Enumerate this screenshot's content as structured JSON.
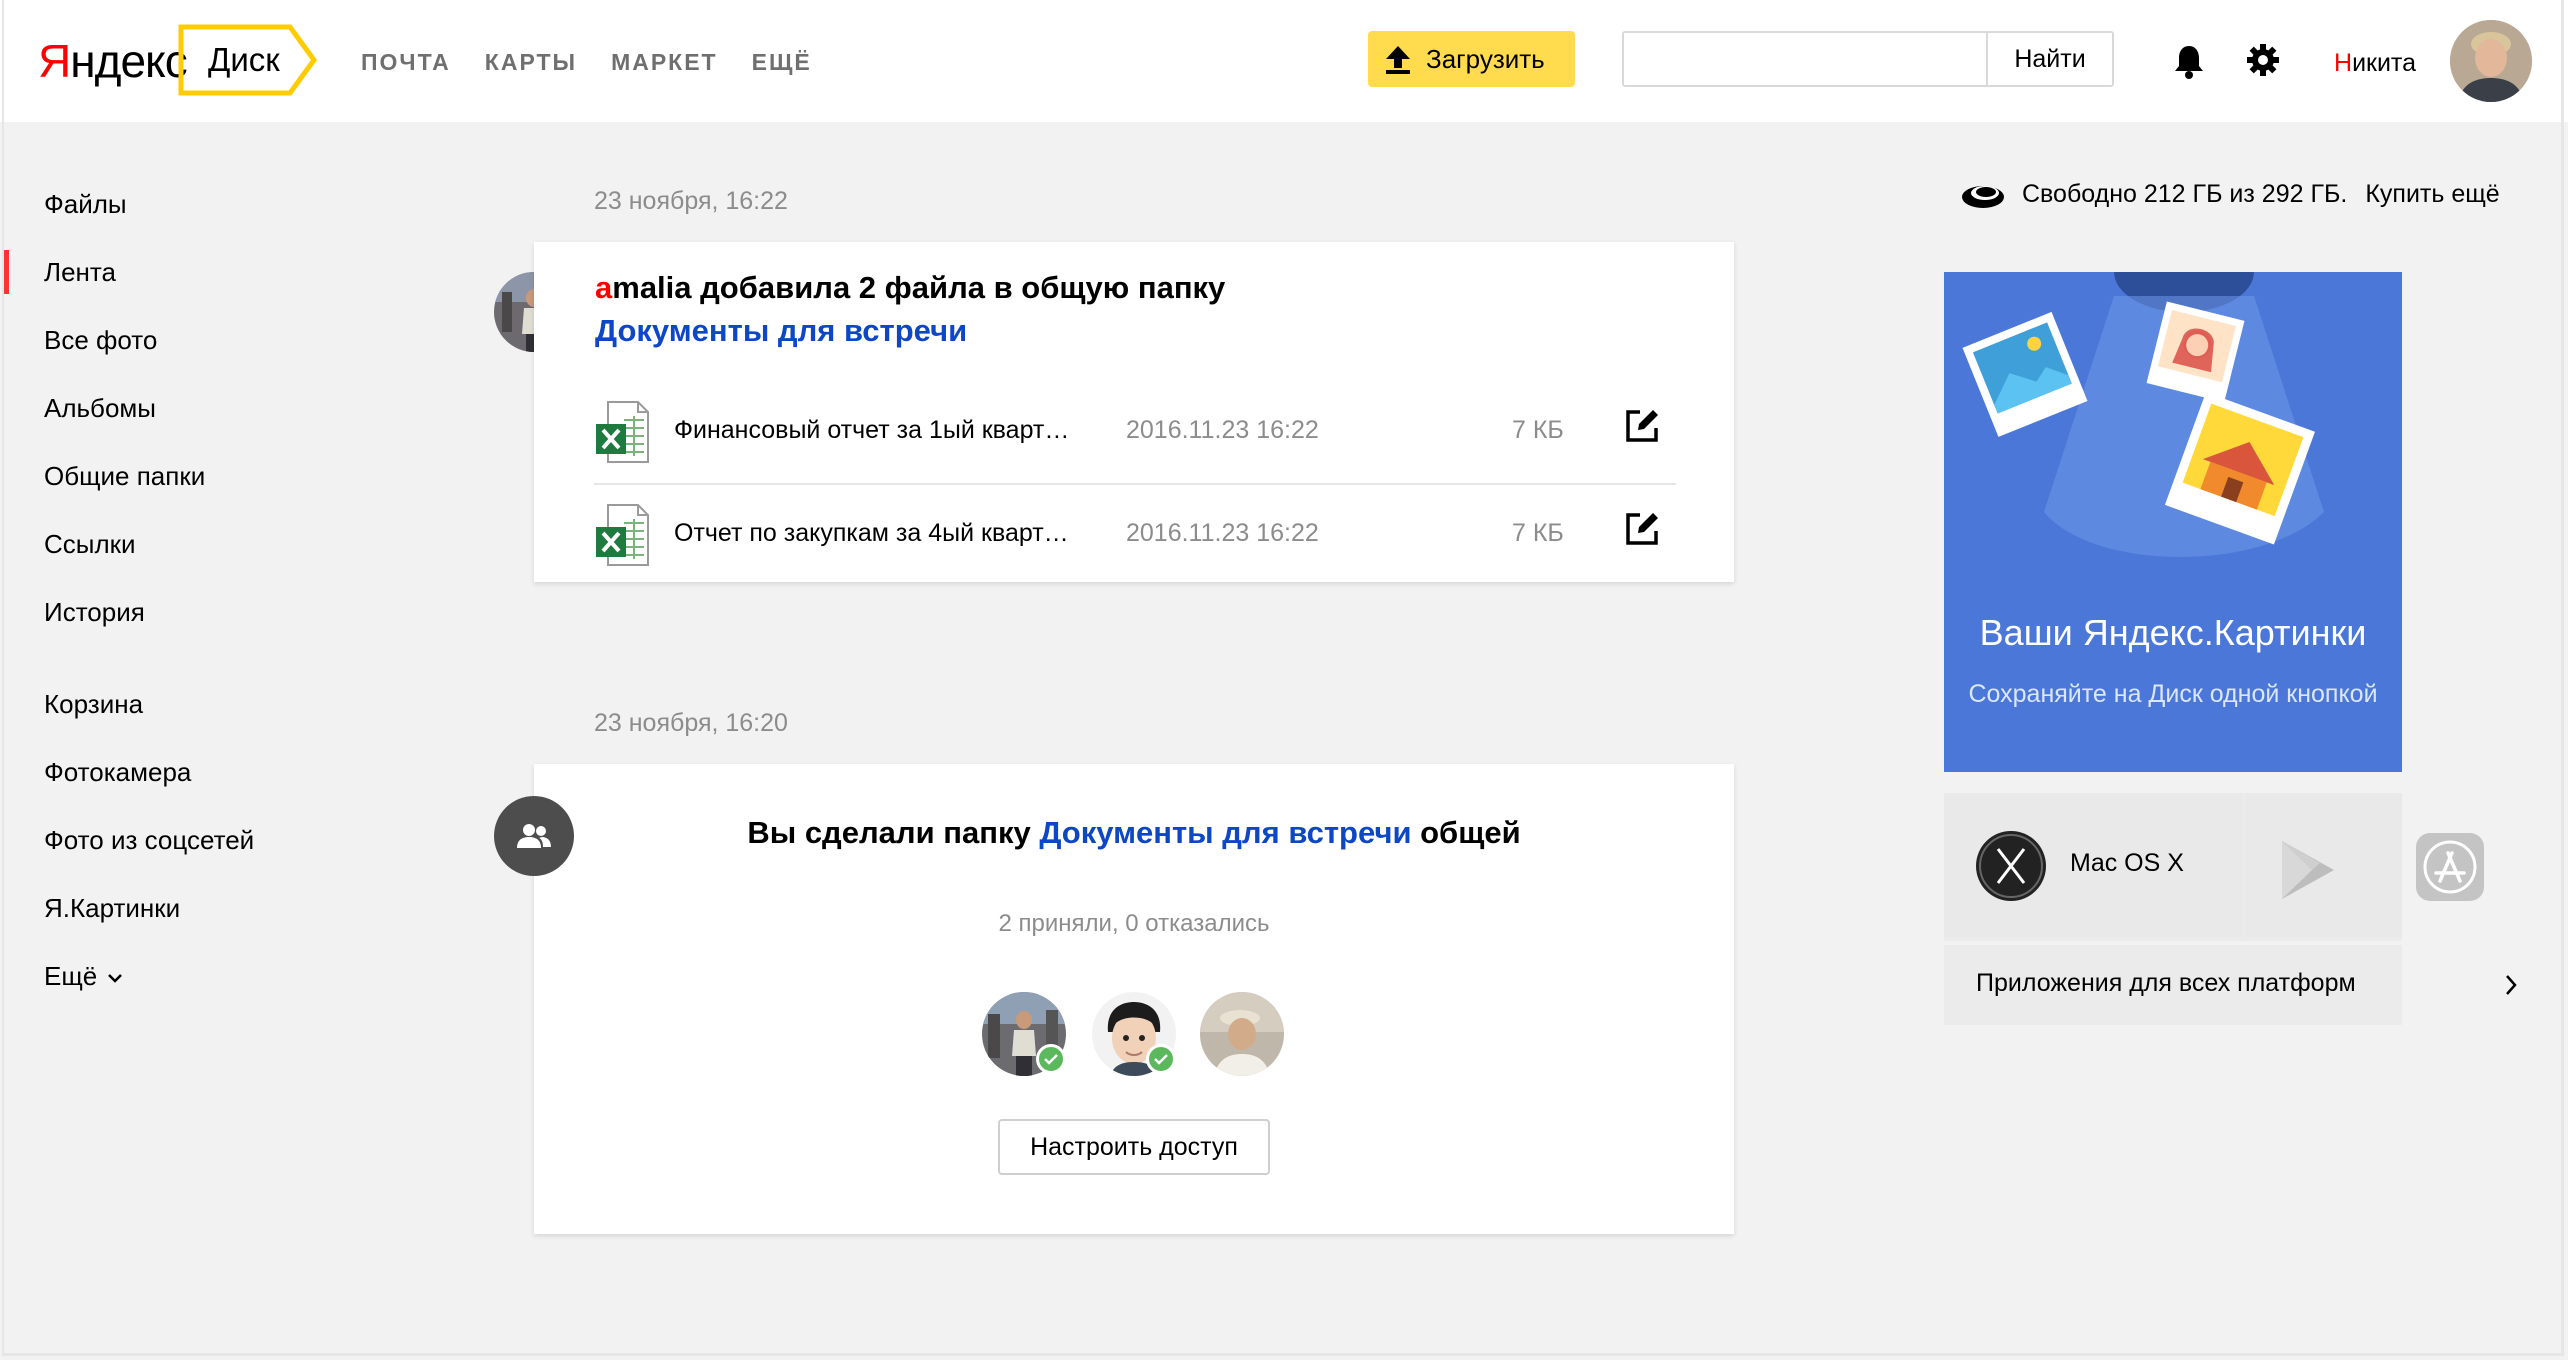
{
  "header": {
    "logo_first": "Я",
    "logo_rest": "ндекс",
    "service": "Диск",
    "nav": [
      "ПОЧТА",
      "КАРТЫ",
      "МАРКЕТ",
      "ЕЩЁ"
    ],
    "upload_label": "Загрузить",
    "search_placeholder": "",
    "search_button": "Найти",
    "user_first": "Н",
    "user_rest": "икита"
  },
  "sidebar": {
    "items": [
      {
        "label": "Файлы"
      },
      {
        "label": "Лента"
      },
      {
        "label": "Все фото"
      },
      {
        "label": "Альбомы"
      },
      {
        "label": "Общие папки"
      },
      {
        "label": "Ссылки"
      },
      {
        "label": "История"
      },
      {
        "label": "Корзина"
      },
      {
        "label": "Фотокамера"
      },
      {
        "label": "Фото из соцсетей"
      },
      {
        "label": "Я.Картинки"
      },
      {
        "label": "Ещё"
      }
    ],
    "active_index": 1
  },
  "feed": {
    "events": [
      {
        "date": "23 ноября, 16:22",
        "actor_first": "a",
        "actor_rest": "malia добавила 2 файла в общую папку",
        "folder": "Документы для встречи",
        "files": [
          {
            "name": "Финансовый отчет за 1ый кварт…",
            "date": "2016.11.23 16:22",
            "size": "7 КБ"
          },
          {
            "name": "Отчет по закупкам за 4ый кварт…",
            "date": "2016.11.23 16:22",
            "size": "7 КБ"
          }
        ]
      },
      {
        "date": "23 ноября, 16:20",
        "title_pre": "Вы сделали папку ",
        "title_link": "Документы для встречи",
        "title_post": " общей",
        "subtitle": "2 приняли, 0 отказались",
        "button": "Настроить доступ"
      }
    ]
  },
  "right": {
    "storage_text": "Свободно 212 ГБ из 292 ГБ.",
    "buy_more": "Купить ещё",
    "promo_title": "Ваши Яндекс.Картинки",
    "promo_subtitle": "Сохраняйте на Диск одной кнопкой",
    "app_macos": "Mac OS X",
    "apps_all": "Приложения для всех платформ"
  },
  "colors": {
    "accent_yellow": "#ffdb4d",
    "link_blue": "#0d47c6",
    "brand_red": "#ff0000",
    "promo_blue": "#4b78d8"
  }
}
